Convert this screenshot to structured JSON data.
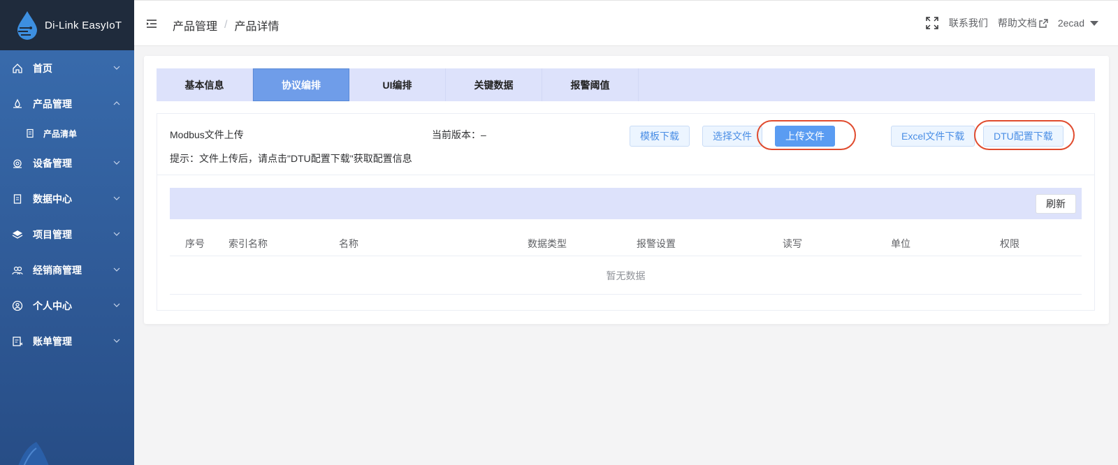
{
  "app": {
    "name": "Di-Link EasyIoT"
  },
  "sidebar": {
    "items": [
      {
        "label": "首页",
        "icon": "home-icon"
      },
      {
        "label": "产品管理",
        "icon": "product-icon",
        "expanded": true,
        "children": [
          {
            "label": "产品清单",
            "icon": "list-icon"
          }
        ]
      },
      {
        "label": "设备管理",
        "icon": "device-icon"
      },
      {
        "label": "数据中心",
        "icon": "data-icon"
      },
      {
        "label": "项目管理",
        "icon": "layers-icon"
      },
      {
        "label": "经销商管理",
        "icon": "dealer-icon"
      },
      {
        "label": "个人中心",
        "icon": "user-icon"
      },
      {
        "label": "账单管理",
        "icon": "bill-icon"
      }
    ]
  },
  "header": {
    "breadcrumb": [
      "产品管理",
      "产品详情"
    ],
    "separator": "/",
    "contact": "联系我们",
    "help": "帮助文档",
    "user": "2ecad"
  },
  "tabs": [
    {
      "label": "基本信息",
      "active": false
    },
    {
      "label": "协议编排",
      "active": true
    },
    {
      "label": "UI编排",
      "active": false
    },
    {
      "label": "关键数据",
      "active": false
    },
    {
      "label": "报警阈值",
      "active": false
    }
  ],
  "upload": {
    "title": "Modbus文件上传",
    "version_label": "当前版本：–",
    "hint": "提示：文件上传后，请点击\"DTU配置下载\"获取配置信息",
    "buttons": {
      "template": "模板下载",
      "choose": "选择文件",
      "upload": "上传文件",
      "excel": "Excel文件下载",
      "dtu": "DTU配置下载"
    }
  },
  "table": {
    "refresh": "刷新",
    "columns": [
      "序号",
      "索引名称",
      "名称",
      "数据类型",
      "报警设置",
      "读写",
      "单位",
      "权限"
    ],
    "empty": "暂无数据"
  },
  "colors": {
    "accent": "#5a9cf2",
    "highlight_ring": "#e04b2e",
    "sidebar": "#3a6eb0"
  }
}
